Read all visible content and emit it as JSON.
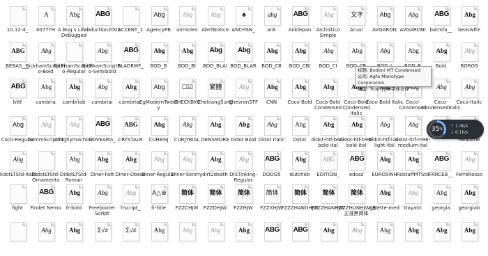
{
  "fonts": [
    {
      "name": "10.12-4_",
      "sample": "",
      "style": "blank"
    },
    {
      "name": "4077TH",
      "sample": "A",
      "style": "serif"
    },
    {
      "name": "A Bug s Life - Debugged",
      "sample": "Abg",
      "style": "serif"
    },
    {
      "name": "abduction2002",
      "sample": "ABG",
      "style": "black"
    },
    {
      "name": "ACCENT_1",
      "sample": "",
      "style": "blank"
    },
    {
      "name": "AgencyFB",
      "sample": "Abg",
      "style": "sans"
    },
    {
      "name": "airmoles",
      "sample": "Abg",
      "style": "light"
    },
    {
      "name": "AlertNotice",
      "sample": "Abg",
      "style": "light"
    },
    {
      "name": "ANCHSN_",
      "sample": "♣",
      "style": "sans"
    },
    {
      "name": "ank",
      "sample": "abg",
      "style": "italic"
    },
    {
      "name": "Anklepan",
      "sample": "ABG",
      "style": "black"
    },
    {
      "name": "Archistico Simple",
      "sample": "Abg",
      "style": "light"
    },
    {
      "name": "Arual",
      "sample": "文字",
      "style": "sans"
    },
    {
      "name": "AVGARDN",
      "sample": "Abg",
      "style": "sans"
    },
    {
      "name": "AVGARDNI",
      "sample": "Abg",
      "style": "italic"
    },
    {
      "name": "batmfa__",
      "sample": "ABG",
      "style": "black"
    },
    {
      "name": "beaswfte",
      "sample": "Abg",
      "style": "bold"
    },
    {
      "name": "BEBAS___",
      "sample": "ABG",
      "style": "bold"
    },
    {
      "name": "BickhamScriptPro-Bold",
      "sample": "Abg",
      "style": "italic"
    },
    {
      "name": "BickhamScriptPro-Regular",
      "sample": "",
      "style": "blank"
    },
    {
      "name": "BickhamScriptPro-Semibold",
      "sample": "Abg",
      "style": "italic"
    },
    {
      "name": "BLADRMF_",
      "sample": "ABG",
      "style": "black"
    },
    {
      "name": "BOD_B",
      "sample": "Abg",
      "style": "bold"
    },
    {
      "name": "BOD_BI",
      "sample": "Abg",
      "style": "bold"
    },
    {
      "name": "BOD_BLAI",
      "sample": "Abg",
      "style": "black"
    },
    {
      "name": "BOD_BLAR",
      "sample": "Abg",
      "style": "black"
    },
    {
      "name": "BOD_CB",
      "sample": "Abg",
      "style": "bold"
    },
    {
      "name": "BOD_CBI",
      "sample": "Abg",
      "style": "bold"
    },
    {
      "name": "BOD_CI",
      "sample": "Abg",
      "style": "italic"
    },
    {
      "name": "BOD_CR",
      "sample": "Abg",
      "style": "serif"
    },
    {
      "name": "BOD_I",
      "sample": "Abg",
      "style": "italic"
    },
    {
      "name": "BOD_R",
      "sample": "Abg",
      "style": "serif"
    },
    {
      "name": "Bold",
      "sample": "Abg",
      "style": "bold"
    },
    {
      "name": "BORG9",
      "sample": "Abg",
      "style": "light"
    },
    {
      "name": "bttf",
      "sample": "ABG",
      "style": "black"
    },
    {
      "name": "cambria",
      "sample": "Abg",
      "style": "serif"
    },
    {
      "name": "cambriab",
      "sample": "Abg",
      "style": "bold"
    },
    {
      "name": "cambriai",
      "sample": "Abg",
      "style": "italic"
    },
    {
      "name": "cambriaz",
      "sample": "Abg",
      "style": "bold"
    },
    {
      "name": "CgModernTwenty",
      "sample": "Abg",
      "style": "sans"
    },
    {
      "name": "CHECKBK0",
      "sample": "☐☑",
      "style": "sans"
    },
    {
      "name": "ChekiangSung",
      "sample": "繁體",
      "style": "serif"
    },
    {
      "name": "ChevronSTF",
      "sample": "Abg",
      "style": "light"
    },
    {
      "name": "CNN",
      "sample": "Abg",
      "style": "bold"
    },
    {
      "name": "Coco-Bold",
      "sample": "Abg",
      "style": "bold"
    },
    {
      "name": "Coco-Bold Condensed",
      "sample": "Abg",
      "style": "bold"
    },
    {
      "name": "Coco-Bold Condensed Italic",
      "sample": "Abg",
      "style": "bold"
    },
    {
      "name": "Coco-Bold Italic",
      "sample": "Abg",
      "style": "bold"
    },
    {
      "name": "Coco-Condensed",
      "sample": "Abg",
      "style": "sans"
    },
    {
      "name": "Coco-CondensedItalic",
      "sample": "Abg",
      "style": "italic"
    },
    {
      "name": "Coco-Italic",
      "sample": "Abg",
      "style": "italic"
    },
    {
      "name": "Coco-Regular",
      "sample": "Abg",
      "style": "sans"
    },
    {
      "name": "CommScriptTT",
      "sample": "Abg",
      "style": "light"
    },
    {
      "name": "coughymachine",
      "sample": "Abg",
      "style": "light"
    },
    {
      "name": "COVEARG_",
      "sample": "ABG",
      "style": "black"
    },
    {
      "name": "CRYSTALR",
      "sample": "ABG",
      "style": "bold"
    },
    {
      "name": "CUHEISJ",
      "sample": "Abg",
      "style": "bold"
    },
    {
      "name": "CURJTRIAL",
      "sample": "Abg",
      "style": "italic"
    },
    {
      "name": "DENSMORE",
      "sample": "Abg",
      "style": "bold"
    },
    {
      "name": "Didot Bold",
      "sample": "Abg",
      "style": "bold"
    },
    {
      "name": "Didot Italic",
      "sample": "Abg",
      "style": "italic"
    },
    {
      "name": "Didot",
      "sample": "Abg",
      "style": "serif"
    },
    {
      "name": "didot-htf-b64-bold-ital",
      "sample": "Abg",
      "style": "bold"
    },
    {
      "name": "didot-htf-b96-bold-ital",
      "sample": "Abg",
      "style": "bold"
    },
    {
      "name": "didot-htf-l24-light-ital",
      "sample": "Abg",
      "style": "italic"
    },
    {
      "name": "didot-htf-m96-medium-ital",
      "sample": "Abg",
      "style": "italic"
    },
    {
      "name": "",
      "sample": "",
      "style": "blank"
    },
    {
      "name": "Headline",
      "sample": "Abg",
      "style": "bold"
    },
    {
      "name": "DidotLTStd-Italic",
      "sample": "Abg",
      "style": "italic"
    },
    {
      "name": "DidotLTStd-Ornaments",
      "sample": "",
      "style": "blank"
    },
    {
      "name": "DidotLTStd-Roman",
      "sample": "Abg",
      "style": "serif"
    },
    {
      "name": "Diner-Fatt",
      "sample": "Abg",
      "style": "bold"
    },
    {
      "name": "Diner-Obese",
      "sample": "Abg",
      "style": "bold"
    },
    {
      "name": "Diner-Regular",
      "sample": "Abg",
      "style": "light"
    },
    {
      "name": "Diner-Skinny",
      "sample": "Abg",
      "style": "light"
    },
    {
      "name": "dirt2death",
      "sample": "Abg",
      "style": "bold"
    },
    {
      "name": "DISTinking-Regular",
      "sample": "Abg",
      "style": "light"
    },
    {
      "name": "DODG5",
      "sample": "ABG",
      "style": "black"
    },
    {
      "name": "dutcheb",
      "sample": "Abg",
      "style": "bold"
    },
    {
      "name": "EDITION_",
      "sample": "ABG",
      "style": "light"
    },
    {
      "name": "edosz",
      "sample": "ABG",
      "style": "black"
    },
    {
      "name": "EUROSWH",
      "sample": "Abg",
      "style": "bold"
    },
    {
      "name": "FalstaffMTStd",
      "sample": "Abg",
      "style": "bold"
    },
    {
      "name": "FARCEB__",
      "sample": "ABG",
      "style": "black"
    },
    {
      "name": "FerroRosso",
      "sample": "Abg",
      "style": "light"
    },
    {
      "name": "fight",
      "sample": "",
      "style": "blank"
    },
    {
      "name": "Findet Nemo",
      "sample": "ABG",
      "style": "black"
    },
    {
      "name": "fr-bold",
      "sample": "Abg",
      "style": "bold"
    },
    {
      "name": "Freebooter Script",
      "sample": "Abg",
      "style": "italic"
    },
    {
      "name": "frscript_",
      "sample": "Abg",
      "style": "light"
    },
    {
      "name": "fr-title",
      "sample": "A△⊕",
      "style": "sans"
    },
    {
      "name": "FZZCHJW",
      "sample": "简体",
      "style": "bold"
    },
    {
      "name": "FZZDHJW",
      "sample": "简体",
      "style": "bold"
    },
    {
      "name": "FZZHJW",
      "sample": "简体",
      "style": "bold"
    },
    {
      "name": "FZZXHJW",
      "sample": "简体",
      "style": "sans"
    },
    {
      "name": "FZZZHANGHJW",
      "sample": "简体",
      "style": "bold"
    },
    {
      "name": "FZZZHANHJW",
      "sample": "简体",
      "style": "bold"
    },
    {
      "name": "FZZZHUNHJW-方正准黑简体",
      "sample": "简体",
      "style": "bold"
    },
    {
      "name": "galette-med",
      "sample": "Abg",
      "style": "bold"
    },
    {
      "name": "Gayatri",
      "sample": "Abg",
      "style": "light"
    },
    {
      "name": "georgia",
      "sample": "Abg",
      "style": "serif"
    },
    {
      "name": "georgiab",
      "sample": "Abg",
      "style": "bold"
    },
    {
      "name": "",
      "sample": "",
      "style": "blank"
    },
    {
      "name": "",
      "sample": "Abg",
      "style": "italic"
    },
    {
      "name": "",
      "sample": "Abg",
      "style": "bold"
    },
    {
      "name": "",
      "sample": "Σ√≠",
      "style": "sans"
    },
    {
      "name": "",
      "sample": "Σ√≠",
      "style": "sans"
    },
    {
      "name": "",
      "sample": "Abg",
      "style": "serif"
    },
    {
      "name": "",
      "sample": "Abg",
      "style": "light"
    },
    {
      "name": "",
      "sample": "Abg",
      "style": "light"
    },
    {
      "name": "",
      "sample": "Abg",
      "style": "bold"
    },
    {
      "name": "",
      "sample": "ABG",
      "style": "black"
    },
    {
      "name": "",
      "sample": "ABG",
      "style": "black"
    },
    {
      "name": "",
      "sample": "Abg",
      "style": "bold"
    },
    {
      "name": "",
      "sample": "Abg",
      "style": "light"
    },
    {
      "name": "",
      "sample": "Abg",
      "style": "serif"
    },
    {
      "name": "",
      "sample": "Abg",
      "style": "bold"
    },
    {
      "name": "",
      "sample": "Abg",
      "style": "bold"
    },
    {
      "name": "",
      "sample": "Abg",
      "style": "bold"
    }
  ],
  "tooltip": {
    "title_line": "标题: Bodoni MT Condensed",
    "company_line": "公司: Agfa Monotype Corporation",
    "type_line": "类型: TrueType 字体文件"
  },
  "monitor": {
    "percent": 35,
    "percent_suffix": "%",
    "up": "1.3k/s",
    "down": "0.1k/s"
  },
  "colors": {
    "background": "#ffffff",
    "gauge_bg": "#2b2f36",
    "gauge_accent": "#7fb7ff"
  }
}
